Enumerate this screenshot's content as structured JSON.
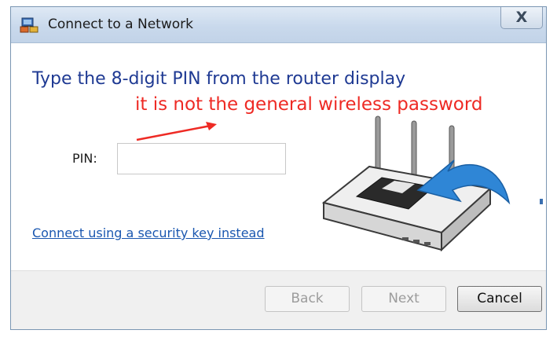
{
  "window": {
    "title": "Connect to a Network",
    "close_label": "X"
  },
  "main": {
    "heading": "Type the 8-digit PIN from the router display",
    "annotation": "it is not the general wireless password",
    "pin_label": "PIN:",
    "pin_value": "",
    "security_key_link": "Connect using a security key instead"
  },
  "footer": {
    "back_label": "Back",
    "next_label": "Next",
    "cancel_label": "Cancel"
  },
  "colors": {
    "heading": "#1f3a93",
    "annotation": "#ee2a24",
    "link": "#1a57b0",
    "router_arrow": "#2f86d6"
  }
}
